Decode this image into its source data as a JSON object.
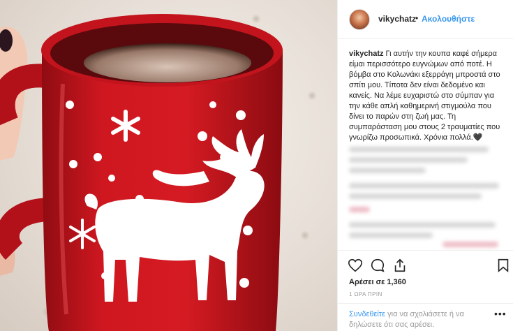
{
  "post": {
    "photo_alt": "red mug with white reindeer and snowflakes",
    "author": "vikychatz",
    "separator": "•",
    "follow_label": "Ακολουθήστε",
    "caption_text": "Γι αυτήν την κουπα καφέ σήμερα είμαι περισσότερο ευγνώμων από ποτέ. Η βόμβα στο Κολωνάκι εξερράγη μπροστά στο σπίτι μου. Τίποτα δεν είναι δεδομένο και κανείς. Να λέμε ευχαριστώ στο σύμπαν για την κάθε απλή καθημερινή στιγμούλα που δίνει το παρών στη ζωή μας. Τη συμπαράσταση μου στους 2 τραυματίες που γνωρίζω προσωπικά. Χρόνια πολλά.🖤",
    "likes_text": "Αρέσει σε 1,360",
    "time_text": "1 ΩΡΑ ΠΡΙΝ"
  },
  "actions": {
    "like_icon": "heart-icon",
    "comment_icon": "comment-icon",
    "share_icon": "share-icon",
    "save_icon": "bookmark-icon"
  },
  "comment_box": {
    "login_link": "Συνδεθείτε",
    "login_text": " για να σχολιάσετε ή να δηλώσετε ότι σας αρέσει.",
    "more_label": "•••"
  },
  "colors": {
    "mug_red": "#c8141e",
    "link_blue": "#3897f0",
    "text": "#262626",
    "muted": "#999999"
  }
}
